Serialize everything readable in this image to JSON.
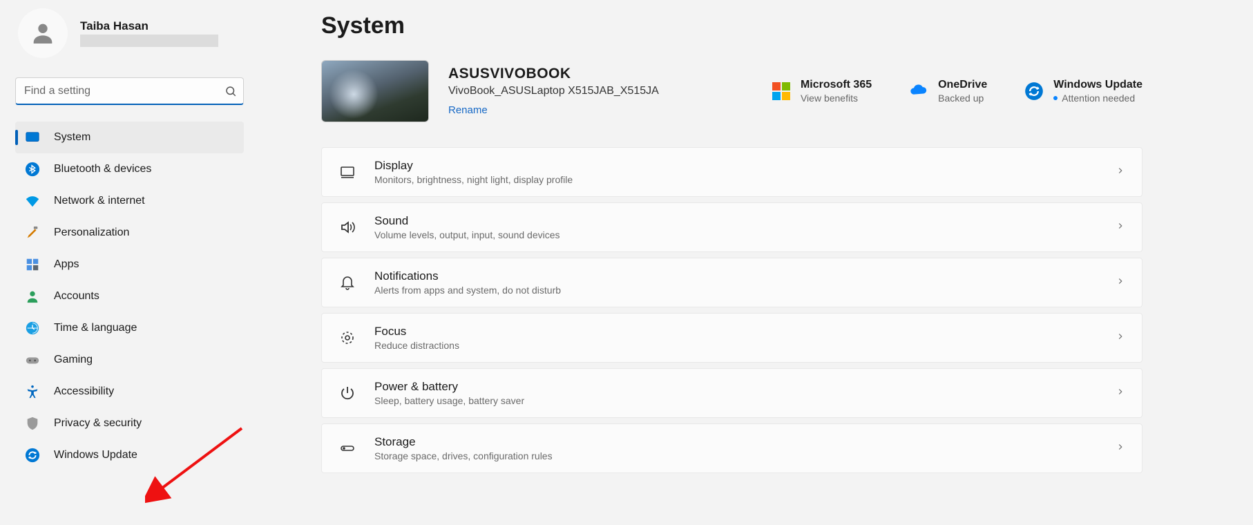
{
  "profile": {
    "name": "Taiba Hasan"
  },
  "search": {
    "placeholder": "Find a setting"
  },
  "sidebar": {
    "items": [
      {
        "id": "system",
        "label": "System",
        "active": true
      },
      {
        "id": "bluetooth",
        "label": "Bluetooth & devices"
      },
      {
        "id": "network",
        "label": "Network & internet"
      },
      {
        "id": "personalization",
        "label": "Personalization"
      },
      {
        "id": "apps",
        "label": "Apps"
      },
      {
        "id": "accounts",
        "label": "Accounts"
      },
      {
        "id": "time",
        "label": "Time & language"
      },
      {
        "id": "gaming",
        "label": "Gaming"
      },
      {
        "id": "accessibility",
        "label": "Accessibility"
      },
      {
        "id": "privacy",
        "label": "Privacy & security"
      },
      {
        "id": "update",
        "label": "Windows Update"
      }
    ]
  },
  "page": {
    "title": "System"
  },
  "device": {
    "name": "ASUSVIVOBOOK",
    "model": "VivoBook_ASUSLaptop X515JAB_X515JA",
    "rename_label": "Rename"
  },
  "status": {
    "m365": {
      "title": "Microsoft 365",
      "sub": "View benefits"
    },
    "onedrive": {
      "title": "OneDrive",
      "sub": "Backed up"
    },
    "update": {
      "title": "Windows Update",
      "sub": "Attention needed"
    }
  },
  "settings": [
    {
      "id": "display",
      "title": "Display",
      "desc": "Monitors, brightness, night light, display profile"
    },
    {
      "id": "sound",
      "title": "Sound",
      "desc": "Volume levels, output, input, sound devices"
    },
    {
      "id": "notifications",
      "title": "Notifications",
      "desc": "Alerts from apps and system, do not disturb"
    },
    {
      "id": "focus",
      "title": "Focus",
      "desc": "Reduce distractions"
    },
    {
      "id": "power",
      "title": "Power & battery",
      "desc": "Sleep, battery usage, battery saver"
    },
    {
      "id": "storage",
      "title": "Storage",
      "desc": "Storage space, drives, configuration rules"
    }
  ]
}
